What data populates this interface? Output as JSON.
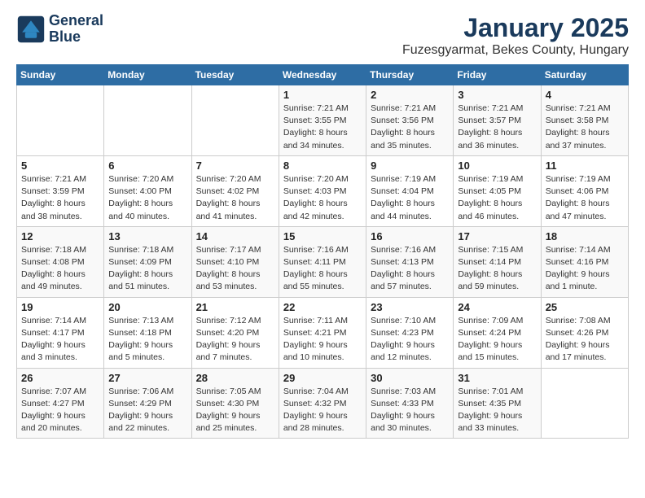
{
  "header": {
    "logo_line1": "General",
    "logo_line2": "Blue",
    "title": "January 2025",
    "subtitle": "Fuzesgyarmat, Bekes County, Hungary"
  },
  "weekdays": [
    "Sunday",
    "Monday",
    "Tuesday",
    "Wednesday",
    "Thursday",
    "Friday",
    "Saturday"
  ],
  "weeks": [
    [
      {
        "day": "",
        "info": ""
      },
      {
        "day": "",
        "info": ""
      },
      {
        "day": "",
        "info": ""
      },
      {
        "day": "1",
        "info": "Sunrise: 7:21 AM\nSunset: 3:55 PM\nDaylight: 8 hours\nand 34 minutes."
      },
      {
        "day": "2",
        "info": "Sunrise: 7:21 AM\nSunset: 3:56 PM\nDaylight: 8 hours\nand 35 minutes."
      },
      {
        "day": "3",
        "info": "Sunrise: 7:21 AM\nSunset: 3:57 PM\nDaylight: 8 hours\nand 36 minutes."
      },
      {
        "day": "4",
        "info": "Sunrise: 7:21 AM\nSunset: 3:58 PM\nDaylight: 8 hours\nand 37 minutes."
      }
    ],
    [
      {
        "day": "5",
        "info": "Sunrise: 7:21 AM\nSunset: 3:59 PM\nDaylight: 8 hours\nand 38 minutes."
      },
      {
        "day": "6",
        "info": "Sunrise: 7:20 AM\nSunset: 4:00 PM\nDaylight: 8 hours\nand 40 minutes."
      },
      {
        "day": "7",
        "info": "Sunrise: 7:20 AM\nSunset: 4:02 PM\nDaylight: 8 hours\nand 41 minutes."
      },
      {
        "day": "8",
        "info": "Sunrise: 7:20 AM\nSunset: 4:03 PM\nDaylight: 8 hours\nand 42 minutes."
      },
      {
        "day": "9",
        "info": "Sunrise: 7:19 AM\nSunset: 4:04 PM\nDaylight: 8 hours\nand 44 minutes."
      },
      {
        "day": "10",
        "info": "Sunrise: 7:19 AM\nSunset: 4:05 PM\nDaylight: 8 hours\nand 46 minutes."
      },
      {
        "day": "11",
        "info": "Sunrise: 7:19 AM\nSunset: 4:06 PM\nDaylight: 8 hours\nand 47 minutes."
      }
    ],
    [
      {
        "day": "12",
        "info": "Sunrise: 7:18 AM\nSunset: 4:08 PM\nDaylight: 8 hours\nand 49 minutes."
      },
      {
        "day": "13",
        "info": "Sunrise: 7:18 AM\nSunset: 4:09 PM\nDaylight: 8 hours\nand 51 minutes."
      },
      {
        "day": "14",
        "info": "Sunrise: 7:17 AM\nSunset: 4:10 PM\nDaylight: 8 hours\nand 53 minutes."
      },
      {
        "day": "15",
        "info": "Sunrise: 7:16 AM\nSunset: 4:11 PM\nDaylight: 8 hours\nand 55 minutes."
      },
      {
        "day": "16",
        "info": "Sunrise: 7:16 AM\nSunset: 4:13 PM\nDaylight: 8 hours\nand 57 minutes."
      },
      {
        "day": "17",
        "info": "Sunrise: 7:15 AM\nSunset: 4:14 PM\nDaylight: 8 hours\nand 59 minutes."
      },
      {
        "day": "18",
        "info": "Sunrise: 7:14 AM\nSunset: 4:16 PM\nDaylight: 9 hours\nand 1 minute."
      }
    ],
    [
      {
        "day": "19",
        "info": "Sunrise: 7:14 AM\nSunset: 4:17 PM\nDaylight: 9 hours\nand 3 minutes."
      },
      {
        "day": "20",
        "info": "Sunrise: 7:13 AM\nSunset: 4:18 PM\nDaylight: 9 hours\nand 5 minutes."
      },
      {
        "day": "21",
        "info": "Sunrise: 7:12 AM\nSunset: 4:20 PM\nDaylight: 9 hours\nand 7 minutes."
      },
      {
        "day": "22",
        "info": "Sunrise: 7:11 AM\nSunset: 4:21 PM\nDaylight: 9 hours\nand 10 minutes."
      },
      {
        "day": "23",
        "info": "Sunrise: 7:10 AM\nSunset: 4:23 PM\nDaylight: 9 hours\nand 12 minutes."
      },
      {
        "day": "24",
        "info": "Sunrise: 7:09 AM\nSunset: 4:24 PM\nDaylight: 9 hours\nand 15 minutes."
      },
      {
        "day": "25",
        "info": "Sunrise: 7:08 AM\nSunset: 4:26 PM\nDaylight: 9 hours\nand 17 minutes."
      }
    ],
    [
      {
        "day": "26",
        "info": "Sunrise: 7:07 AM\nSunset: 4:27 PM\nDaylight: 9 hours\nand 20 minutes."
      },
      {
        "day": "27",
        "info": "Sunrise: 7:06 AM\nSunset: 4:29 PM\nDaylight: 9 hours\nand 22 minutes."
      },
      {
        "day": "28",
        "info": "Sunrise: 7:05 AM\nSunset: 4:30 PM\nDaylight: 9 hours\nand 25 minutes."
      },
      {
        "day": "29",
        "info": "Sunrise: 7:04 AM\nSunset: 4:32 PM\nDaylight: 9 hours\nand 28 minutes."
      },
      {
        "day": "30",
        "info": "Sunrise: 7:03 AM\nSunset: 4:33 PM\nDaylight: 9 hours\nand 30 minutes."
      },
      {
        "day": "31",
        "info": "Sunrise: 7:01 AM\nSunset: 4:35 PM\nDaylight: 9 hours\nand 33 minutes."
      },
      {
        "day": "",
        "info": ""
      }
    ]
  ]
}
